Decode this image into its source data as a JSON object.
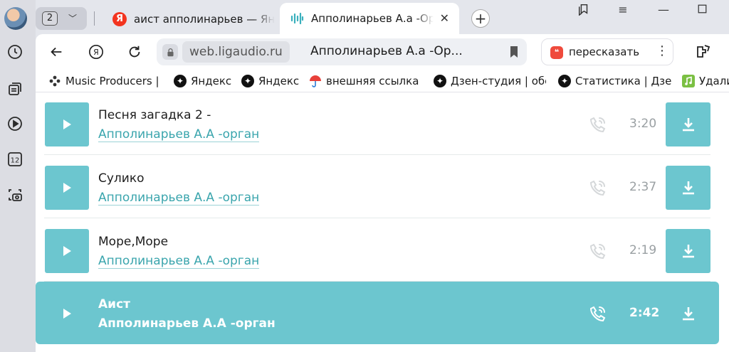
{
  "tabs": {
    "group_count": "2",
    "items": [
      {
        "title": "аист апполинарьев — Яндекс"
      },
      {
        "title": "Апполинарьев А.а -Орган"
      }
    ]
  },
  "toolbar": {
    "domain": "web.ligaudio.ru",
    "page_title": "Апполинарьев А.а -Ор...",
    "retell_label": "пересказать"
  },
  "bookmarks": [
    {
      "label": "Music Producers |"
    },
    {
      "label": "Яндекс"
    },
    {
      "label": "Яндекс"
    },
    {
      "label": "внешняя ссылка Г"
    },
    {
      "label": "Дзен-студия | обе"
    },
    {
      "label": "Статистика | Дзен"
    },
    {
      "label": "Удали"
    }
  ],
  "tracks": [
    {
      "title": "Песня загадка 2 -",
      "artist": "Апполинарьев А.А -орган",
      "duration": "3:20"
    },
    {
      "title": "Сулико",
      "artist": "Апполинарьев А.А -орган",
      "duration": "2:37"
    },
    {
      "title": "Море,Море",
      "artist": "Апполинарьев А.А -орган",
      "duration": "2:19"
    },
    {
      "title": "Аист",
      "artist": "Апполинарьев А.А -орган",
      "duration": "2:42"
    }
  ],
  "colors": {
    "accent": "#6cc6cf",
    "link": "#3aa5ad",
    "yandex_red": "#f3341f"
  }
}
